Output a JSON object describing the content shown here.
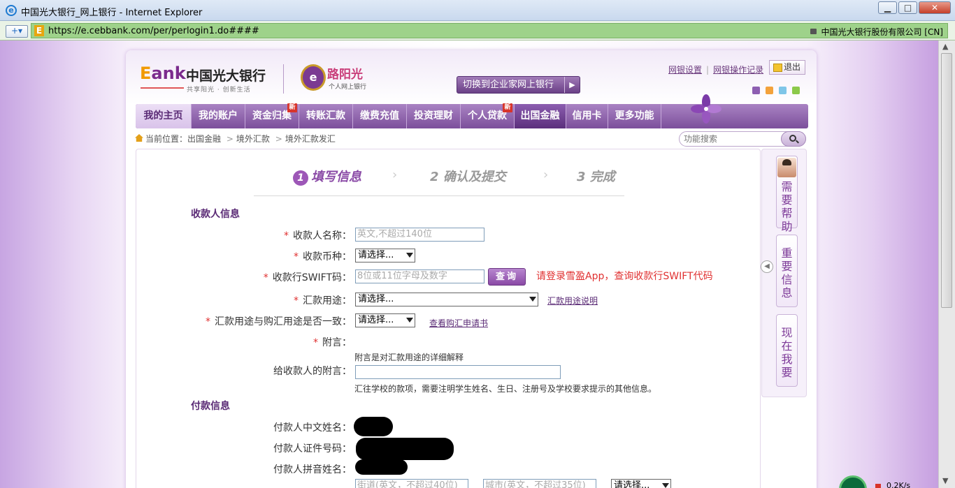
{
  "window": {
    "title": "中国光大银行_网上银行 - Internet Explorer",
    "minimize": "▁",
    "maximize": "□",
    "close": "✕"
  },
  "address": {
    "url": "https://e.cebbank.com/per/perlogin1.do####",
    "cert": "中国光大银行股份有限公司 [CN]",
    "e_icon": "E",
    "nav_plus": "+▾"
  },
  "header": {
    "logo_e": "E",
    "logo_bank": "ank",
    "logo_name": "中国光大银行",
    "logo_slogan": "共享阳光 · 创新生活",
    "lyg_icon": "e",
    "lyg_name": "路阳光",
    "lyg_sub": "个人网上银行",
    "switch_label": "切换到企业家网上银行",
    "switch_arrow": "▶",
    "link_settings": "网银设置",
    "link_records": "网银操作记录",
    "logout": "退出",
    "theme_colors": [
      "#8e5fb2",
      "#f3a23b",
      "#7fc6e8",
      "#8cc94a"
    ]
  },
  "menu": [
    {
      "label": "我的主页"
    },
    {
      "label": "我的账户"
    },
    {
      "label": "资金归集",
      "badge": "新"
    },
    {
      "label": "转账汇款"
    },
    {
      "label": "缴费充值"
    },
    {
      "label": "投资理财"
    },
    {
      "label": "个人贷款",
      "badge": "新"
    },
    {
      "label": "出国金融"
    },
    {
      "label": "信用卡"
    },
    {
      "label": "更多功能"
    }
  ],
  "breadcrumb": {
    "prefix": "当前位置：",
    "items": [
      "出国金融",
      "境外汇款",
      "境外汇款发汇"
    ],
    "sep": ">"
  },
  "search": {
    "placeholder": "功能搜索"
  },
  "steps": [
    {
      "num": "1",
      "label": "填写信息",
      "active": true
    },
    {
      "num": "2",
      "label": "确认及提交",
      "active": false
    },
    {
      "num": "3",
      "label": "完成",
      "active": false
    }
  ],
  "step_sep": "›",
  "form": {
    "payee_section": "收款人信息",
    "req_mark": "*",
    "payee_name_label": "收款人名称：",
    "payee_name_placeholder": "英文,不超过140位",
    "currency_label": "收款币种：",
    "currency_value": "请选择...",
    "swift_label": "收款行SWIFT码：",
    "swift_placeholder": "8位或11位字母及数字",
    "query_btn": "查询",
    "swift_tip": "请登录雪盈App，查询收款行SWIFT代码",
    "purpose_label": "汇款用途：",
    "purpose_value": "请选择...",
    "purpose_link": "汇款用途说明",
    "consistent_label": "汇款用途与购汇用途是否一致：",
    "consistent_value": "请选择...",
    "consistent_link": "查看购汇申请书",
    "postscript_label": "附言：",
    "postscript_note": "附言是对汇款用途的详细解释",
    "message_label": "给收款人的附言：",
    "message_note": "汇往学校的款项，需要注明学生姓名、生日、注册号及学校要求提示的其他信息。",
    "payer_section": "付款信息",
    "payer_cn_label": "付款人中文姓名：",
    "payer_id_label": "付款人证件号码：",
    "payer_py_label": "付款人拼音姓名：",
    "street_placeholder": "街道(英文，不超过40位)",
    "city_placeholder": "城市(英文，不超过35位)",
    "country_value": "请选择..."
  },
  "sidebar": {
    "help": "需要帮助",
    "important": "重要信息",
    "now": "现在我要",
    "arrow": "◀"
  },
  "status": {
    "speed": "0.2K/s"
  }
}
